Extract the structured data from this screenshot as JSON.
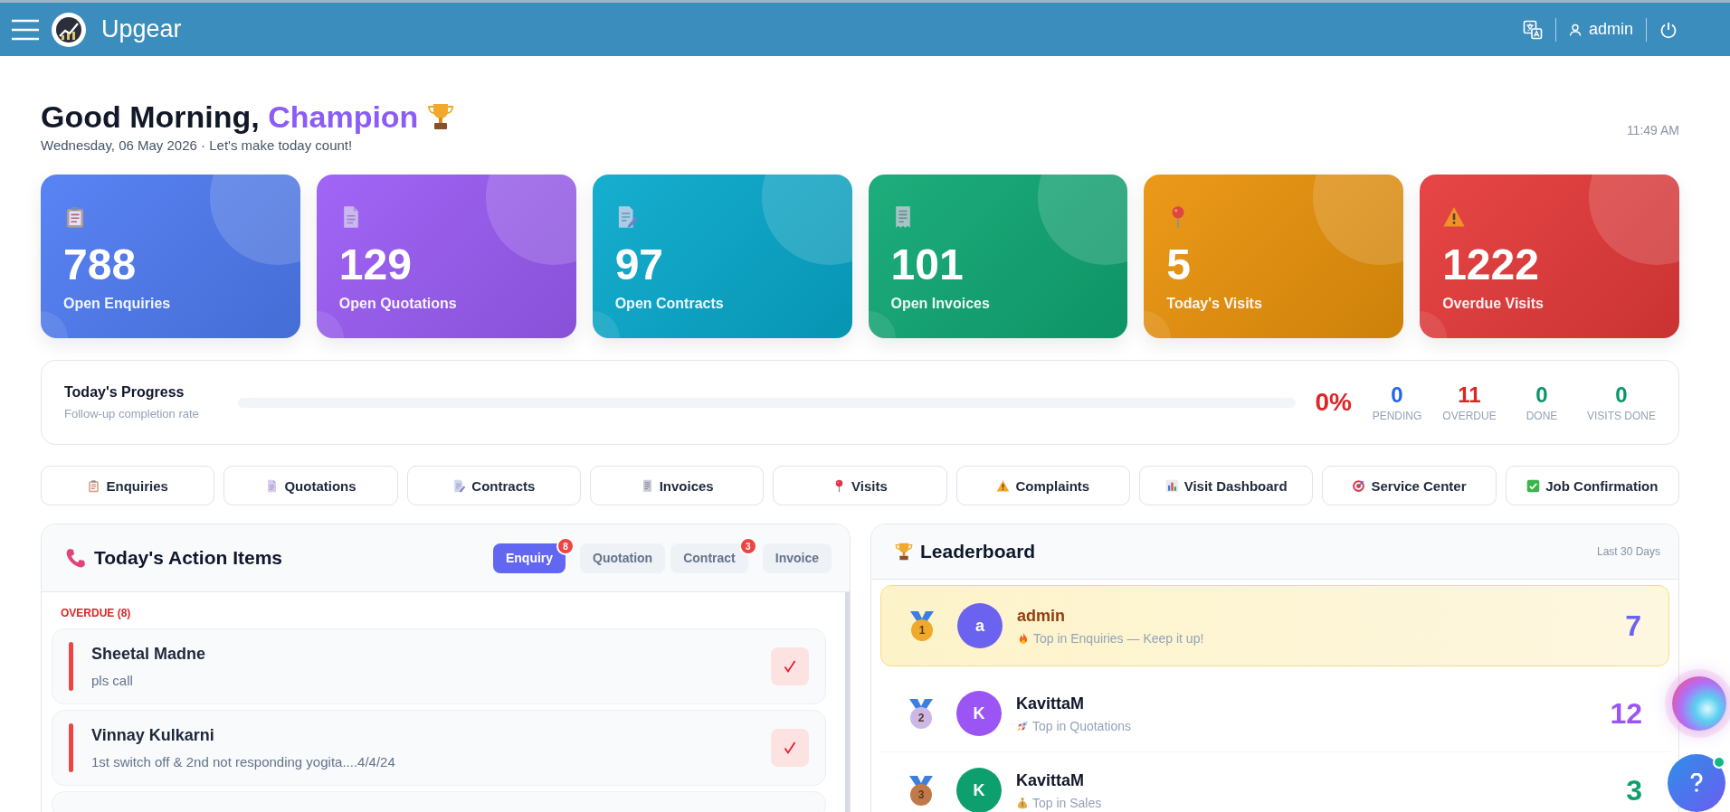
{
  "header": {
    "app_name": "Upgear",
    "user": "admin"
  },
  "greeting": {
    "salutation": "Good Morning,",
    "name": "Champion",
    "date_line": "Wednesday, 06 May 2026 · Let's make today count!",
    "time": "11:49 AM"
  },
  "stats": [
    {
      "value": "788",
      "label": "Open Enquiries",
      "color": "#4f7cf3",
      "kind": "clipboard"
    },
    {
      "value": "129",
      "label": "Open Quotations",
      "color": "#9b5cf5",
      "kind": "document"
    },
    {
      "value": "97",
      "label": "Open Contracts",
      "color": "#08a9cc",
      "kind": "contract"
    },
    {
      "value": "101",
      "label": "Open Invoices",
      "color": "#10a874",
      "kind": "receipt"
    },
    {
      "value": "5",
      "label": "Today's Visits",
      "color": "#ea930b",
      "kind": "pin"
    },
    {
      "value": "1222",
      "label": "Overdue Visits",
      "color": "#e63a3a",
      "kind": "warning"
    }
  ],
  "progress": {
    "title": "Today's Progress",
    "subtitle": "Follow-up completion rate",
    "level": 0,
    "percent": "0%",
    "counts": [
      {
        "value": "0",
        "label": "PENDING",
        "color": "#2563eb"
      },
      {
        "value": "11",
        "label": "OVERDUE",
        "color": "#dc2626"
      },
      {
        "value": "0",
        "label": "DONE",
        "color": "#059669"
      },
      {
        "value": "0",
        "label": "VISITS DONE",
        "color": "#059669"
      }
    ]
  },
  "nav": [
    {
      "label": "Enquiries",
      "kind": "clipboard"
    },
    {
      "label": "Quotations",
      "kind": "document"
    },
    {
      "label": "Contracts",
      "kind": "contract"
    },
    {
      "label": "Invoices",
      "kind": "receipt"
    },
    {
      "label": "Visits",
      "kind": "pin"
    },
    {
      "label": "Complaints",
      "kind": "warning"
    },
    {
      "label": "Visit Dashboard",
      "kind": "chart"
    },
    {
      "label": "Service Center",
      "kind": "target"
    },
    {
      "label": "Job Confirmation",
      "kind": "check"
    }
  ],
  "actions": {
    "title": "Today's Action Items",
    "tabs": [
      {
        "label": "Enquiry",
        "selected": true,
        "badge": "8"
      },
      {
        "label": "Quotation",
        "selected": false
      },
      {
        "label": "Contract",
        "selected": false,
        "badge": "3"
      },
      {
        "label": "Invoice",
        "selected": false
      }
    ],
    "section": "OVERDUE (8)",
    "items": [
      {
        "name": "Sheetal Madne",
        "note": "pls call"
      },
      {
        "name": "Vinnay Kulkarni",
        "note": "1st switch off & 2nd not responding yogita....4/4/24"
      }
    ]
  },
  "leaderboard": {
    "title": "Leaderboard",
    "period": "Last 30 Days",
    "entries": [
      {
        "rank": "1",
        "kind": "gold",
        "initial": "a",
        "name": "admin",
        "note": "Top in Enquiries — Keep it up!",
        "score": "7",
        "color": "#6b63f0",
        "highlighted": true
      },
      {
        "rank": "2",
        "kind": "silver",
        "initial": "K",
        "name": "KavittaM",
        "note": "Top in Quotations",
        "score": "12",
        "color": "#9b55f5",
        "highlighted": false
      },
      {
        "rank": "3",
        "kind": "bronze",
        "initial": "K",
        "name": "KavittaM",
        "note": "Top in Sales",
        "score": "3",
        "color": "#0e9f6e",
        "highlighted": false
      }
    ]
  }
}
